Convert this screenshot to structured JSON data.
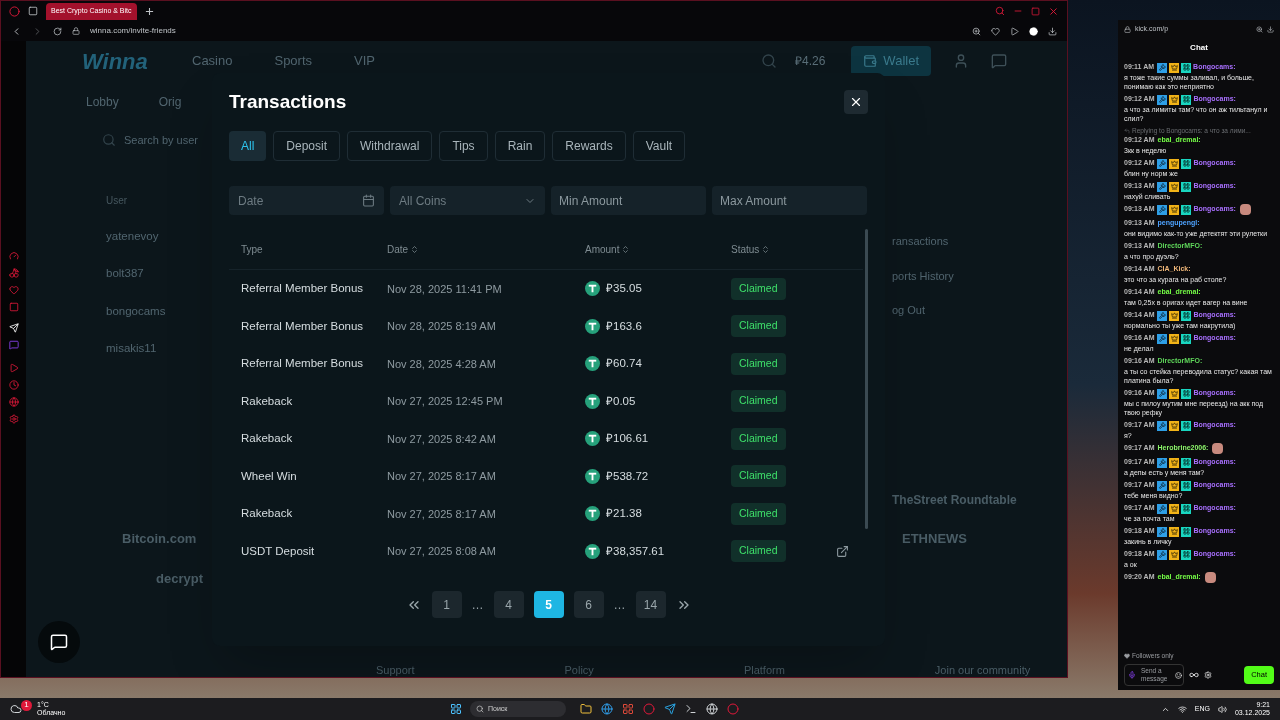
{
  "browser": {
    "tab_title": "Best Crypto Casino & Bitc",
    "url": "winna.com/invite-friends"
  },
  "site": {
    "logo": "Winna",
    "nav": [
      "Casino",
      "Sports",
      "VIP"
    ],
    "balance": "₽4.26",
    "wallet": "Wallet",
    "subnav": [
      "Lobby",
      "Orig"
    ],
    "search_placeholder": "Search by user",
    "user_column": "User",
    "users": [
      "yatenevoy",
      "bolt387",
      "bongocams",
      "misakis11"
    ],
    "side_menu": [
      "ransactions",
      "ports History",
      "og Out"
    ],
    "partners_left": [
      "Bitcoin.com",
      "decrypt"
    ],
    "partners_right": [
      "TheStreet Roundtable",
      "ETHNEWS"
    ],
    "footer": [
      "Support",
      "Policy",
      "Platform",
      "Join our community"
    ]
  },
  "modal": {
    "title": "Transactions",
    "tabs": [
      {
        "label": "All",
        "selected": true
      },
      {
        "label": "Deposit",
        "selected": false
      },
      {
        "label": "Withdrawal",
        "selected": false
      },
      {
        "label": "Tips",
        "selected": false
      },
      {
        "label": "Rain",
        "selected": false
      },
      {
        "label": "Rewards",
        "selected": false
      },
      {
        "label": "Vault",
        "selected": false
      }
    ],
    "filters": {
      "date_placeholder": "Date",
      "coin": "All Coins",
      "min_placeholder": "Min Amount",
      "max_placeholder": "Max Amount"
    },
    "columns": [
      {
        "label": "Type",
        "sortable": false
      },
      {
        "label": "Date",
        "sortable": true
      },
      {
        "label": "Amount",
        "sortable": true
      },
      {
        "label": "Status",
        "sortable": true
      }
    ],
    "rows": [
      {
        "type": "Referral Member Bonus",
        "date": "Nov 28, 2025 11:41 PM",
        "amount": "₽35.05",
        "status": "Claimed",
        "link": false
      },
      {
        "type": "Referral Member Bonus",
        "date": "Nov 28, 2025 8:19 AM",
        "amount": "₽163.6",
        "status": "Claimed",
        "link": false
      },
      {
        "type": "Referral Member Bonus",
        "date": "Nov 28, 2025 4:28 AM",
        "amount": "₽60.74",
        "status": "Claimed",
        "link": false
      },
      {
        "type": "Rakeback",
        "date": "Nov 27, 2025 12:45 PM",
        "amount": "₽0.05",
        "status": "Claimed",
        "link": false
      },
      {
        "type": "Rakeback",
        "date": "Nov 27, 2025 8:42 AM",
        "amount": "₽106.61",
        "status": "Claimed",
        "link": false
      },
      {
        "type": "Wheel Win",
        "date": "Nov 27, 2025 8:17 AM",
        "amount": "₽538.72",
        "status": "Claimed",
        "link": false
      },
      {
        "type": "Rakeback",
        "date": "Nov 27, 2025 8:17 AM",
        "amount": "₽21.38",
        "status": "Claimed",
        "link": false
      },
      {
        "type": "USDT Deposit",
        "date": "Nov 27, 2025 8:08 AM",
        "amount": "₽38,357.61",
        "status": "Claimed",
        "link": true
      }
    ],
    "pages": [
      {
        "label": "1",
        "kind": "page",
        "selected": false
      },
      {
        "label": "…",
        "kind": "ellipsis",
        "selected": false
      },
      {
        "label": "4",
        "kind": "page",
        "selected": false
      },
      {
        "label": "5",
        "kind": "page",
        "selected": true
      },
      {
        "label": "6",
        "kind": "page",
        "selected": false
      },
      {
        "label": "…",
        "kind": "ellipsis",
        "selected": false
      },
      {
        "label": "14",
        "kind": "page",
        "selected": false
      }
    ]
  },
  "chat": {
    "url": "kick.com/p",
    "title": "Chat",
    "messages": [
      {
        "time": "09:11 AM",
        "badges": true,
        "user": "Bongocams:",
        "color": "#a970ff",
        "text": "я тоже такие суммы заливал, и больше, понимаю как это неприятно",
        "emote": false
      },
      {
        "time": "09:12 AM",
        "badges": true,
        "user": "Bongocams:",
        "color": "#a970ff",
        "text": "а что за лимиты там? что он аж тильтанул и слил?",
        "emote": false
      },
      {
        "reply": "Replying to Bongocams: а что за лими...",
        "time": "09:12 AM",
        "badges": false,
        "user": "ebal_dremal:",
        "color": "#75fd46",
        "text": "3кк в неделю",
        "emote": false
      },
      {
        "time": "09:12 AM",
        "badges": true,
        "user": "Bongocams:",
        "color": "#a970ff",
        "text": "блин ну норм же",
        "emote": false
      },
      {
        "time": "09:13 AM",
        "badges": true,
        "user": "Bongocams:",
        "color": "#a970ff",
        "text": "нахуй сливать",
        "emote": false
      },
      {
        "time": "09:13 AM",
        "badges": true,
        "user": "Bongocams:",
        "color": "#a970ff",
        "emote": true
      },
      {
        "time": "09:13 AM",
        "badges": false,
        "user": "pengupengl:",
        "color": "#4ea3ff",
        "text": "они видимо как-то уже детектят эти рулетки",
        "emote": false
      },
      {
        "time": "09:13 AM",
        "badges": false,
        "user": "DirectorMFO:",
        "color": "#5fd65a",
        "text": "а что про дуэль?",
        "emote": false
      },
      {
        "time": "09:14 AM",
        "badges": false,
        "user": "CIA_Kick:",
        "color": "#f2b97a",
        "text": "это что за курага на раб столе?",
        "emote": false
      },
      {
        "time": "09:14 AM",
        "badges": false,
        "user": "ebal_dremal:",
        "color": "#75fd46",
        "text": "там 0,25х в оригах идет вагер на вине",
        "emote": false
      },
      {
        "time": "09:14 AM",
        "badges": true,
        "user": "Bongocams:",
        "color": "#a970ff",
        "text": "нормально ты уже там накрутила)",
        "emote": false
      },
      {
        "time": "09:16 AM",
        "badges": true,
        "user": "Bongocams:",
        "color": "#a970ff",
        "text": "не делал",
        "emote": false
      },
      {
        "time": "09:16 AM",
        "badges": false,
        "user": "DirectorMFO:",
        "color": "#5fd65a",
        "text": "а ты со стейка переводила статус? какая там платина была?",
        "emote": false
      },
      {
        "time": "09:16 AM",
        "badges": true,
        "user": "Bongocams:",
        "color": "#a970ff",
        "text": "мы с пилоу мутим мне переезд) на акк под твою рефку",
        "emote": false
      },
      {
        "time": "09:17 AM",
        "badges": true,
        "user": "Bongocams:",
        "color": "#a970ff",
        "text": "я?",
        "emote": false
      },
      {
        "time": "09:17 AM",
        "badges": false,
        "user": "Herobrine2006:",
        "color": "#8cf56a",
        "emote": true
      },
      {
        "time": "09:17 AM",
        "badges": true,
        "user": "Bongocams:",
        "color": "#a970ff",
        "text": "а депы есть у меня там?",
        "emote": false
      },
      {
        "time": "09:17 AM",
        "badges": true,
        "user": "Bongocams:",
        "color": "#a970ff",
        "text": "тебе меня видно?",
        "emote": false
      },
      {
        "time": "09:17 AM",
        "badges": true,
        "user": "Bongocams:",
        "color": "#a970ff",
        "text": "че за почта там",
        "emote": false
      },
      {
        "time": "09:18 AM",
        "badges": true,
        "user": "Bongocams:",
        "color": "#a970ff",
        "text": "закинь в личку",
        "emote": false
      },
      {
        "time": "09:18 AM",
        "badges": true,
        "user": "Bongocams:",
        "color": "#a970ff",
        "text": "а ок",
        "emote": false
      },
      {
        "time": "09:20 AM",
        "badges": false,
        "user": "ebal_dremal:",
        "color": "#75fd46",
        "emote": true
      }
    ],
    "mode": "Followers only",
    "input_placeholder": "Send a message",
    "send": "Chat"
  },
  "taskbar": {
    "weather_badge": "1",
    "temperature": "1°C",
    "condition": "Облачно",
    "search_placeholder": "Поиск",
    "language": "ENG",
    "time": "9:21",
    "date": "03.12.2025"
  }
}
